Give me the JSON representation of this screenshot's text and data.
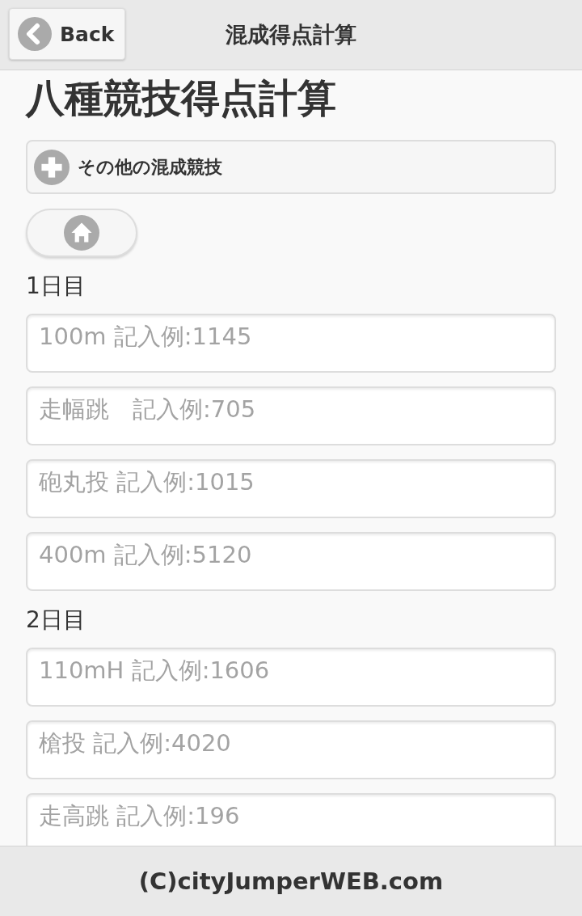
{
  "header": {
    "back_button": "Back",
    "title": "混成得点計算"
  },
  "page_title": "八種競技得点計算",
  "collapsible": {
    "label": "その他の混成競技",
    "expanded": false
  },
  "sections": [
    {
      "heading": "1日目",
      "fields": [
        {
          "placeholder": "100m 記入例:1145"
        },
        {
          "placeholder": "走幅跳　記入例:705"
        },
        {
          "placeholder": "砲丸投 記入例:1015"
        },
        {
          "placeholder": "400m 記入例:5120"
        }
      ]
    },
    {
      "heading": "2日目",
      "fields": [
        {
          "placeholder": "110mH 記入例:1606"
        },
        {
          "placeholder": "槍投 記入例:4020"
        },
        {
          "placeholder": "走高跳 記入例:196"
        }
      ]
    }
  ],
  "footer": "(C)cityJumperWEB.com"
}
